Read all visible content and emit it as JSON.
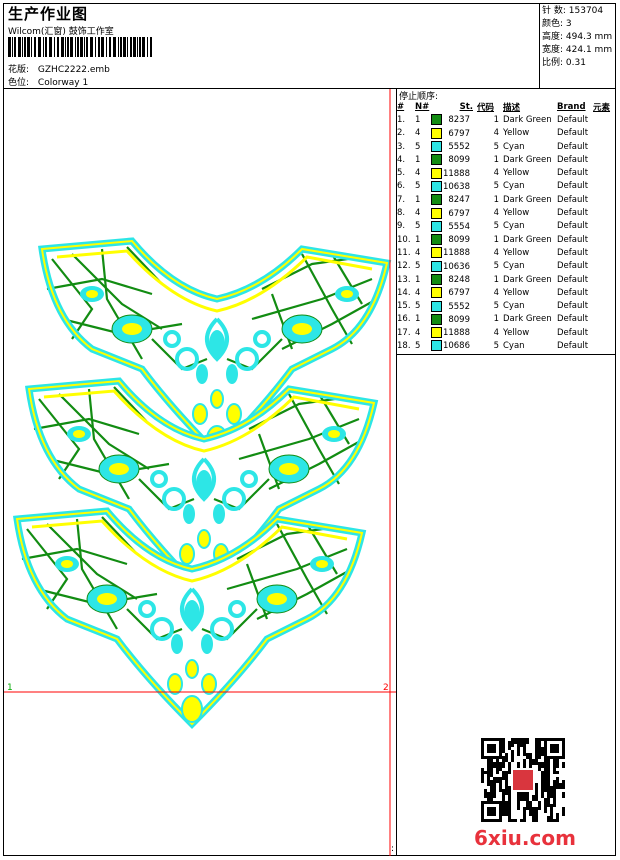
{
  "header": {
    "title": "生产作业图",
    "company": "Wilcom(汇窗) 鼓饰工作室",
    "design_label": "花版:",
    "design_value": "GZHC2222.emb",
    "colorway_label": "色位:",
    "colorway_value": "Colorway 1"
  },
  "stats": [
    {
      "label": "针 数:",
      "value": "153704"
    },
    {
      "label": "颜色:",
      "value": "3"
    },
    {
      "label": "高度:",
      "value": "494.3 mm"
    },
    {
      "label": "宽度:",
      "value": "424.1 mm"
    },
    {
      "label": "比例:",
      "value": "0.31"
    }
  ],
  "stop_sequence": {
    "label": "停止顺序:",
    "headers": [
      "#",
      "N#",
      "St.",
      "代码",
      "描述",
      "Brand",
      "元素"
    ],
    "rows": [
      {
        "n": "1.",
        "needle": "1",
        "color": "#128c12",
        "st": "8237",
        "code": "1",
        "desc": "Dark Green",
        "brand": "Default"
      },
      {
        "n": "2.",
        "needle": "4",
        "color": "#ffff00",
        "st": "6797",
        "code": "4",
        "desc": "Yellow",
        "brand": "Default"
      },
      {
        "n": "3.",
        "needle": "5",
        "color": "#2de6e6",
        "st": "5552",
        "code": "5",
        "desc": "Cyan",
        "brand": "Default"
      },
      {
        "n": "4.",
        "needle": "1",
        "color": "#128c12",
        "st": "8099",
        "code": "1",
        "desc": "Dark Green",
        "brand": "Default"
      },
      {
        "n": "5.",
        "needle": "4",
        "color": "#ffff00",
        "st": "11888",
        "code": "4",
        "desc": "Yellow",
        "brand": "Default"
      },
      {
        "n": "6.",
        "needle": "5",
        "color": "#2de6e6",
        "st": "10638",
        "code": "5",
        "desc": "Cyan",
        "brand": "Default"
      },
      {
        "n": "7.",
        "needle": "1",
        "color": "#128c12",
        "st": "8247",
        "code": "1",
        "desc": "Dark Green",
        "brand": "Default"
      },
      {
        "n": "8.",
        "needle": "4",
        "color": "#ffff00",
        "st": "6797",
        "code": "4",
        "desc": "Yellow",
        "brand": "Default"
      },
      {
        "n": "9.",
        "needle": "5",
        "color": "#2de6e6",
        "st": "5554",
        "code": "5",
        "desc": "Cyan",
        "brand": "Default"
      },
      {
        "n": "10.",
        "needle": "1",
        "color": "#128c12",
        "st": "8099",
        "code": "1",
        "desc": "Dark Green",
        "brand": "Default"
      },
      {
        "n": "11.",
        "needle": "4",
        "color": "#ffff00",
        "st": "11888",
        "code": "4",
        "desc": "Yellow",
        "brand": "Default"
      },
      {
        "n": "12.",
        "needle": "5",
        "color": "#2de6e6",
        "st": "10636",
        "code": "5",
        "desc": "Cyan",
        "brand": "Default"
      },
      {
        "n": "13.",
        "needle": "1",
        "color": "#128c12",
        "st": "8248",
        "code": "1",
        "desc": "Dark Green",
        "brand": "Default"
      },
      {
        "n": "14.",
        "needle": "4",
        "color": "#ffff00",
        "st": "6797",
        "code": "4",
        "desc": "Yellow",
        "brand": "Default"
      },
      {
        "n": "15.",
        "needle": "5",
        "color": "#2de6e6",
        "st": "5552",
        "code": "5",
        "desc": "Cyan",
        "brand": "Default"
      },
      {
        "n": "16.",
        "needle": "1",
        "color": "#128c12",
        "st": "8099",
        "code": "1",
        "desc": "Dark Green",
        "brand": "Default"
      },
      {
        "n": "17.",
        "needle": "4",
        "color": "#ffff00",
        "st": "11888",
        "code": "4",
        "desc": "Yellow",
        "brand": "Default"
      },
      {
        "n": "18.",
        "needle": "5",
        "color": "#2de6e6",
        "st": "10686",
        "code": "5",
        "desc": "Cyan",
        "brand": "Default"
      }
    ]
  },
  "preview": {
    "marker_1": "1",
    "marker_2": "2",
    "marker_colon": ":",
    "thread_colors": {
      "green": "#128c12",
      "yellow": "#ffff00",
      "cyan": "#2de6e6"
    }
  },
  "watermark": "6xiu.com"
}
